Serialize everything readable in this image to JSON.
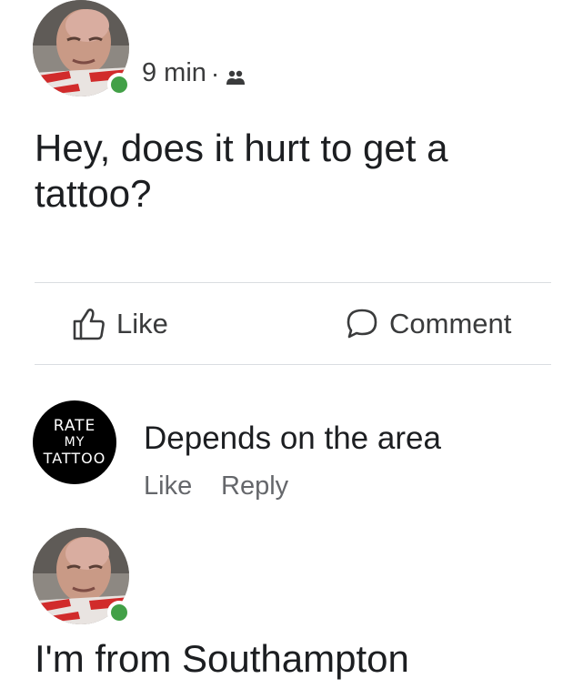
{
  "post": {
    "time": "9 min",
    "separator": "·",
    "audience_icon": "friends-icon",
    "text": "Hey, does it hurt to get a tattoo?"
  },
  "actions": {
    "like_label": "Like",
    "like_icon": "thumbs-up-icon",
    "comment_label": "Comment",
    "comment_icon": "speech-bubble-icon"
  },
  "comment": {
    "avatar_lines": [
      "RATE",
      "MY",
      "TATTOO"
    ],
    "text": "Depends on the area",
    "like_label": "Like",
    "reply_label": "Reply"
  },
  "reply": {
    "text": "I'm from Southampton"
  },
  "colors": {
    "online": "#42a047",
    "text": "#1c1e21",
    "secondary": "#65676b",
    "divider": "#dadde1"
  }
}
